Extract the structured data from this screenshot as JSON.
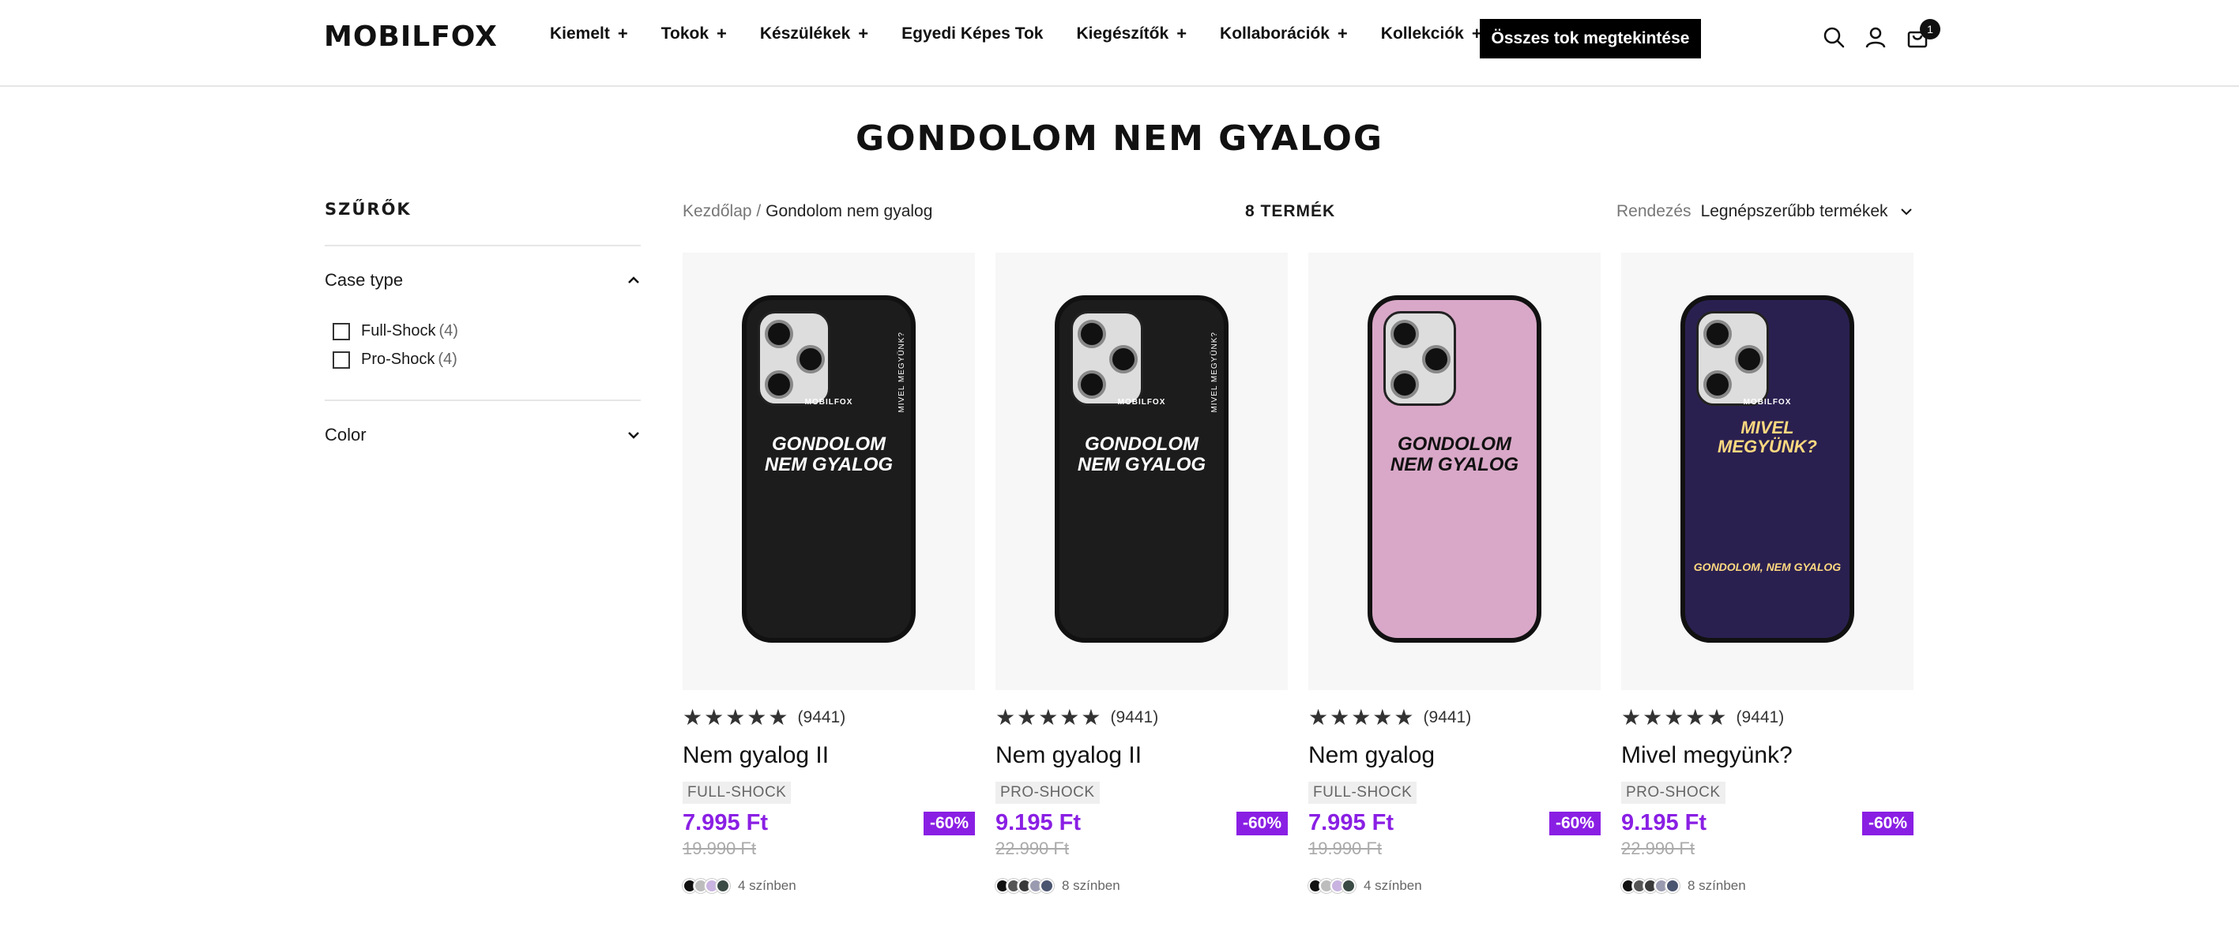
{
  "header": {
    "logo": "MOBILFOX",
    "nav": [
      {
        "label": "Kiemelt",
        "plus": true
      },
      {
        "label": "Tokok",
        "plus": true
      },
      {
        "label": "Készülékek",
        "plus": true
      },
      {
        "label": "Egyedi Képes Tok",
        "plus": false
      },
      {
        "label": "Kiegészítők",
        "plus": true
      },
      {
        "label": "Kollaborációk",
        "plus": true
      },
      {
        "label": "Kollekciók",
        "plus": true
      }
    ],
    "plus_symbol": "+",
    "all_cases_button": "Összes tok megtekintése",
    "icons": [
      "search-icon",
      "account-icon",
      "cart-icon"
    ],
    "cart_count": "1"
  },
  "page_title": "GONDOLOM NEM GYALOG",
  "sidebar": {
    "title": "SZŰRŐK",
    "filters": [
      {
        "label": "Case type",
        "expanded": true,
        "options": [
          {
            "label": "Full-Shock",
            "count": "(4)"
          },
          {
            "label": "Pro-Shock",
            "count": "(4)"
          }
        ]
      },
      {
        "label": "Color",
        "expanded": false,
        "options": []
      }
    ]
  },
  "toolbar": {
    "breadcrumb_home": "Kezdőlap",
    "breadcrumb_sep": "/",
    "breadcrumb_current": "Gondolom nem gyalog",
    "product_count": "8 TERMÉK",
    "sort_label": "Rendezés",
    "sort_value": "Legnépszerűbb termékek"
  },
  "products": [
    {
      "title": "Nem gyalog II",
      "tag": "FULL-SHOCK",
      "rating_count": "(9441)",
      "price": "7.995 Ft",
      "old_price": "19.990 Ft",
      "discount": "-60%",
      "colors_text": "4 színben",
      "swatches": [
        "#111111",
        "#bdbdbd",
        "#c9b3e0",
        "#3a4a45"
      ],
      "case_color": "#1c1c1c",
      "art_text": "GONDOLOM NEM GYALOG",
      "side_text": "MIVEL MEGYÜNK?",
      "brand": "MOBILFOX"
    },
    {
      "title": "Nem gyalog II",
      "tag": "PRO-SHOCK",
      "rating_count": "(9441)",
      "price": "9.195 Ft",
      "old_price": "22.990 Ft",
      "discount": "-60%",
      "colors_text": "8 színben",
      "swatches": [
        "#111111",
        "#555555",
        "#3a3a3a",
        "#9a9ab0",
        "#4a5570"
      ],
      "case_color": "#1c1c1c",
      "art_text": "GONDOLOM NEM GYALOG",
      "side_text": "MIVEL MEGYÜNK?",
      "brand": "MOBILFOX"
    },
    {
      "title": "Nem gyalog",
      "tag": "FULL-SHOCK",
      "rating_count": "(9441)",
      "price": "7.995 Ft",
      "old_price": "19.990 Ft",
      "discount": "-60%",
      "colors_text": "4 színben",
      "swatches": [
        "#111111",
        "#bdbdbd",
        "#c9b3e0",
        "#3a4a45"
      ],
      "case_color": "#d9a8c8",
      "art_text": "GONDOLOM NEM GYALOG",
      "side_text": "",
      "brand": ""
    },
    {
      "title": "Mivel megyünk?",
      "tag": "PRO-SHOCK",
      "rating_count": "(9441)",
      "price": "9.195 Ft",
      "old_price": "22.990 Ft",
      "discount": "-60%",
      "colors_text": "8 színben",
      "swatches": [
        "#111111",
        "#555555",
        "#3a3a3a",
        "#9a9ab0",
        "#4a5570"
      ],
      "case_color": "#2a2050",
      "art_text": "MIVEL MEGYÜNK?",
      "side_text": "GONDOLOM, NEM GYALOG",
      "brand": "MOBILFOX"
    }
  ],
  "stars_glyph": "★★★★★",
  "colors": {
    "accent": "#8a1fe4",
    "button_bg": "#000000"
  }
}
